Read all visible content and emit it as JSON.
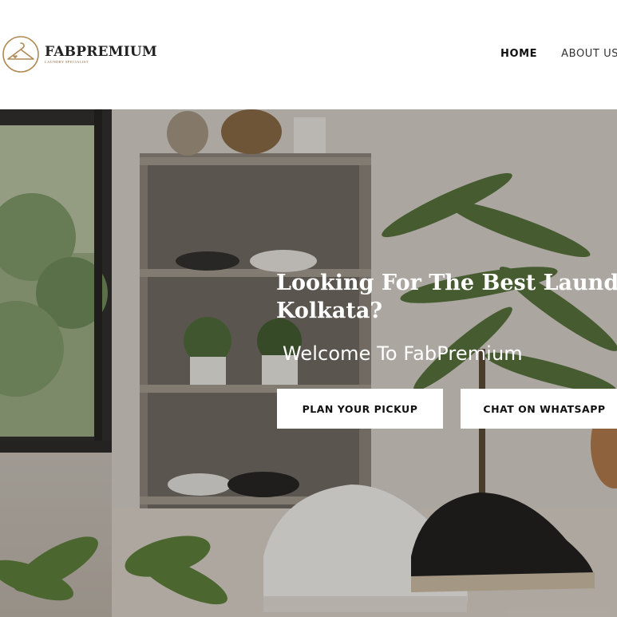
{
  "brand": {
    "name": "FABPREMIUM",
    "tagline": "LAUNDRY SPECIALIST",
    "logo_icon": "hanger-heart-icon",
    "accent": "#b08a55"
  },
  "nav": {
    "items": [
      {
        "label": "HOME",
        "active": true
      },
      {
        "label": "ABOUT US",
        "active": false
      }
    ]
  },
  "hero": {
    "title_line1": "Looking For The Best Laundry In",
    "title_line2": "Kolkata?",
    "subtitle": "Welcome To FabPremium",
    "buttons": {
      "pickup": "PLAN YOUR PICKUP",
      "whatsapp": "CHAT ON WHATSAPP"
    }
  }
}
